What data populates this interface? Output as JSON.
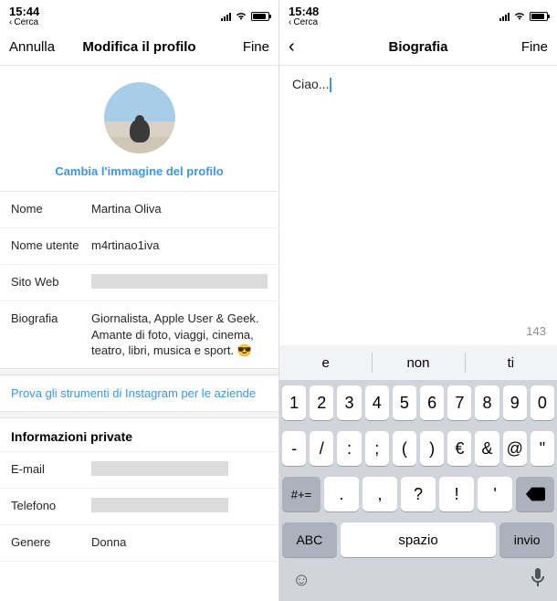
{
  "left": {
    "status": {
      "time": "15:44",
      "back_label": "Cerca"
    },
    "nav": {
      "cancel": "Annulla",
      "title": "Modifica il profilo",
      "done": "Fine"
    },
    "change_photo": "Cambia l'immagine del profilo",
    "fields": {
      "name_label": "Nome",
      "name_value": "Martina Oliva",
      "username_label": "Nome utente",
      "username_value": "m4rtinao1iva",
      "website_label": "Sito Web",
      "bio_label": "Biografia",
      "bio_value": "Giornalista, Apple User & Geek. Amante di foto, viaggi, cinema, teatro, libri, musica e sport. 😎"
    },
    "biz_link": "Prova gli strumenti di Instagram per le aziende",
    "private_header": "Informazioni private",
    "private": {
      "email_label": "E-mail",
      "phone_label": "Telefono",
      "gender_label": "Genere",
      "gender_value": "Donna"
    }
  },
  "right": {
    "status": {
      "time": "15:48",
      "back_label": "Cerca"
    },
    "nav": {
      "title": "Biografia",
      "done": "Fine"
    },
    "bio_text": "Ciao...",
    "char_counter": "143",
    "keyboard": {
      "suggestions": [
        "e",
        "non",
        "ti"
      ],
      "row1": [
        "1",
        "2",
        "3",
        "4",
        "5",
        "6",
        "7",
        "8",
        "9",
        "0"
      ],
      "row2": [
        "-",
        "/",
        ":",
        ";",
        "(",
        ")",
        "€",
        "&",
        "@",
        "\""
      ],
      "row3_shift": "#+=",
      "row3": [
        ".",
        ",",
        "?",
        "!",
        "'"
      ],
      "abc": "ABC",
      "space": "spazio",
      "return": "invio"
    }
  }
}
